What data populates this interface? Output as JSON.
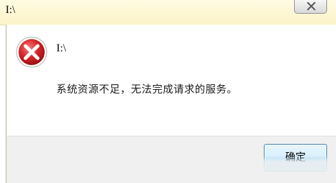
{
  "window": {
    "title": "I:\\"
  },
  "dialog": {
    "title": "I:\\",
    "message": "系统资源不足，无法完成请求的服务。",
    "ok_label": "确定"
  },
  "icons": {
    "error": "error-icon",
    "close": "close-icon"
  },
  "colors": {
    "error_red": "#d8262b",
    "titlebar": "#fbf3c7",
    "button_border": "#3c7fb1"
  }
}
